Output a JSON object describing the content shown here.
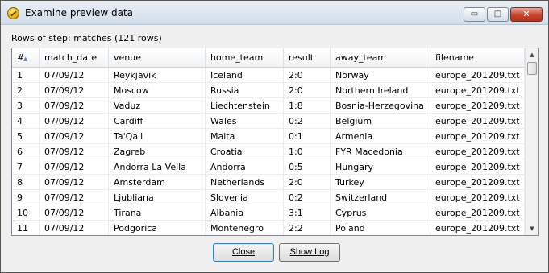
{
  "window": {
    "title": "Examine preview data"
  },
  "window_controls": {
    "minimize": "▭",
    "maximize": "□",
    "close": "✕"
  },
  "rows_label": "Rows of step: matches (121 rows)",
  "table": {
    "columns": [
      "#",
      "match_date",
      "venue",
      "home_team",
      "result",
      "away_team",
      "filename"
    ],
    "rows": [
      [
        "1",
        "07/09/12",
        "Reykjavik",
        "Iceland",
        "2:0",
        "Norway",
        "europe_201209.txt"
      ],
      [
        "2",
        "07/09/12",
        "Moscow",
        "Russia",
        "2:0",
        "Northern Ireland",
        "europe_201209.txt"
      ],
      [
        "3",
        "07/09/12",
        "Vaduz",
        "Liechtenstein",
        "1:8",
        "Bosnia-Herzegovina",
        "europe_201209.txt"
      ],
      [
        "4",
        "07/09/12",
        "Cardiff",
        "Wales",
        "0:2",
        "Belgium",
        "europe_201209.txt"
      ],
      [
        "5",
        "07/09/12",
        "Ta'Qali",
        "Malta",
        "0:1",
        "Armenia",
        "europe_201209.txt"
      ],
      [
        "6",
        "07/09/12",
        "Zagreb",
        "Croatia",
        "1:0",
        "FYR Macedonia",
        "europe_201209.txt"
      ],
      [
        "7",
        "07/09/12",
        "Andorra La Vella",
        "Andorra",
        "0:5",
        "Hungary",
        "europe_201209.txt"
      ],
      [
        "8",
        "07/09/12",
        "Amsterdam",
        "Netherlands",
        "2:0",
        "Turkey",
        "europe_201209.txt"
      ],
      [
        "9",
        "07/09/12",
        "Ljubliana",
        "Slovenia",
        "0:2",
        "Switzerland",
        "europe_201209.txt"
      ],
      [
        "10",
        "07/09/12",
        "Tirana",
        "Albania",
        "3:1",
        "Cyprus",
        "europe_201209.txt"
      ],
      [
        "11",
        "07/09/12",
        "Podgorica",
        "Montenegro",
        "2:2",
        "Poland",
        "europe_201209.txt"
      ]
    ]
  },
  "buttons": {
    "close": "Close",
    "show_log": "Show Log"
  },
  "icons": {
    "app": "spoon-icon",
    "sort": "sort-ascending-icon",
    "scroll_up": "▲",
    "scroll_down": "▼"
  }
}
